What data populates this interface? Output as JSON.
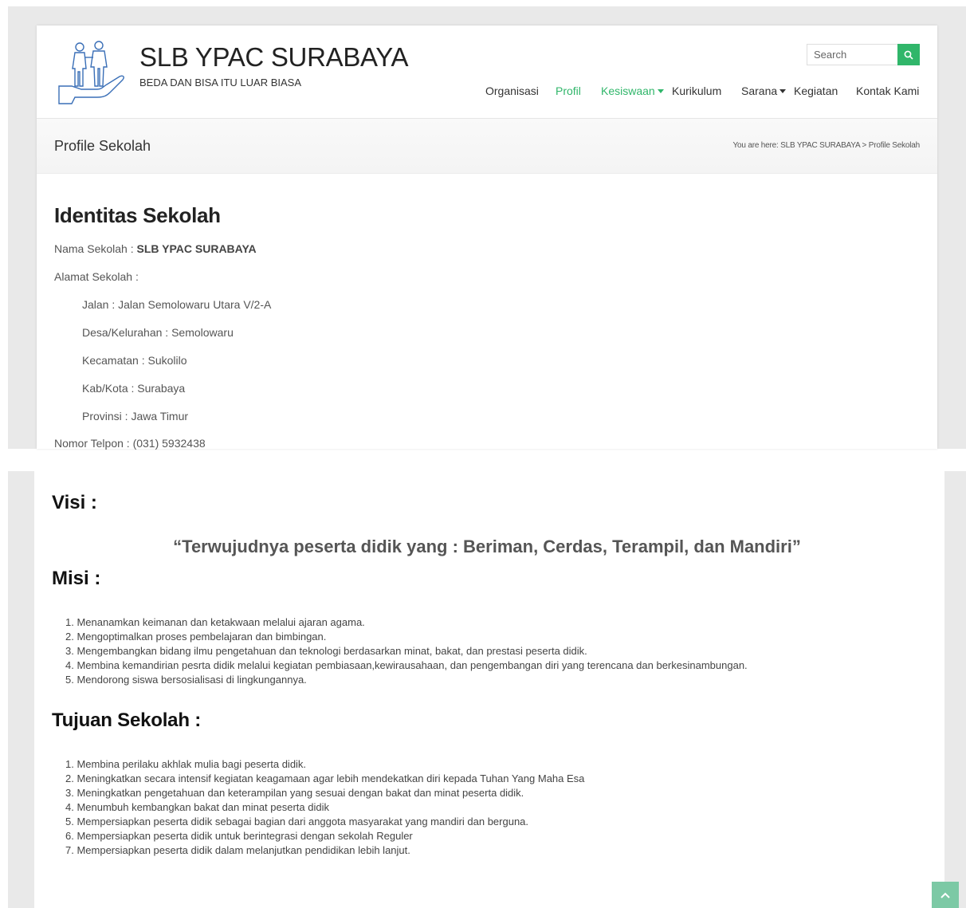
{
  "site": {
    "title": "SLB YPAC SURABAYA",
    "tagline": "BEDA DAN BISA ITU LUAR BIASA",
    "logo_icon": "two-people-in-hand-icon"
  },
  "search": {
    "placeholder": "Search",
    "icon": "search-icon"
  },
  "nav": [
    {
      "label": "Organisasi",
      "active": false,
      "dropdown": false
    },
    {
      "label": "Profil",
      "active": true,
      "dropdown": false
    },
    {
      "label": "Kesiswaan",
      "active": true,
      "dropdown": true
    },
    {
      "label": "Kurikulum",
      "active": false,
      "dropdown": false
    },
    {
      "label": "Sarana",
      "active": false,
      "dropdown": true
    },
    {
      "label": "Kegiatan",
      "active": false,
      "dropdown": false
    },
    {
      "label": "Kontak Kami",
      "active": false,
      "dropdown": false
    }
  ],
  "page": {
    "title": "Profile Sekolah",
    "breadcrumb": "You are here: SLB YPAC SURABAYA > Profile Sekolah"
  },
  "identitas": {
    "heading": "Identitas Sekolah",
    "nama_label": "Nama Sekolah : ",
    "nama_value": "SLB YPAC SURABAYA",
    "alamat_label": "Alamat Sekolah :",
    "jalan": "Jalan : Jalan Semolowaru Utara V/2-A",
    "desa": "Desa/Kelurahan : Semolowaru",
    "kecamatan": "Kecamatan : Sukolilo",
    "kota": "Kab/Kota : Surabaya",
    "provinsi": "Provinsi : Jawa Timur",
    "telpon": "Nomor Telpon : (031) 5932438"
  },
  "visi": {
    "heading": "Visi :",
    "text": "“Terwujudnya peserta didik yang : Beriman, Cerdas, Terampil, dan Mandiri”"
  },
  "misi": {
    "heading": "Misi :",
    "items": [
      "1. Menanamkan keimanan dan ketakwaan melalui ajaran agama.",
      "2. Mengoptimalkan proses pembelajaran dan bimbingan.",
      "3. Mengembangkan bidang ilmu pengetahuan dan teknologi berdasarkan minat, bakat, dan prestasi peserta didik.",
      "4. Membina kemandirian pesrta didik melalui kegiatan pembiasaan,kewirausahaan, dan pengembangan diri yang terencana dan berkesinambungan.",
      "5. Mendorong siswa bersosialisasi di lingkungannya."
    ]
  },
  "tujuan": {
    "heading": "Tujuan  Sekolah :",
    "items": [
      "1. Membina perilaku akhlak mulia bagi peserta didik.",
      "2. Meningkatkan  secara intensif kegiatan keagamaan agar lebih mendekatkan diri kepada Tuhan Yang Maha Esa",
      "3. Meningkatkan pengetahuan dan keterampilan yang sesuai dengan bakat dan minat peserta didik.",
      "4. Menumbuh kembangkan bakat dan minat peserta didik",
      "5. Mempersiapkan peserta didik sebagai bagian dari anggota masyarakat yang mandiri dan berguna.",
      "6. Mempersiapkan peserta didik untuk berintegrasi dengan sekolah Reguler",
      "7. Mempersiapkan peserta didik dalam melanjutkan pendidikan lebih lanjut."
    ]
  },
  "colors": {
    "accent": "#30b66a",
    "scroll_top": "#7cc9a5",
    "frame": "#e9e9e9"
  },
  "scroll_top_icon": "chevron-up-icon"
}
